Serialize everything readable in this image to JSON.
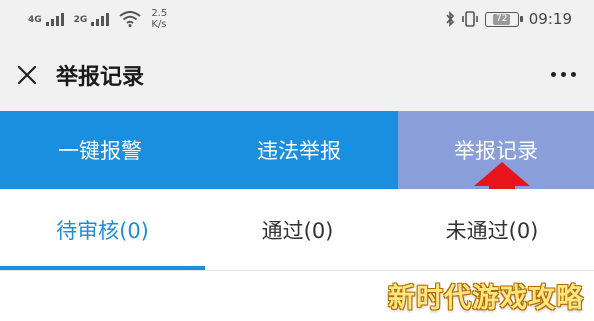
{
  "status_bar": {
    "signal1_tag": "4G",
    "signal2_tag": "2G",
    "net_speed_value": "2.5",
    "net_speed_unit": "K/s",
    "battery_level": "72",
    "time": "09:19",
    "icons": [
      "signal-icon",
      "signal-icon",
      "wifi-icon",
      "bluetooth-icon",
      "vibrate-icon",
      "battery-icon"
    ]
  },
  "header": {
    "title": "举报记录",
    "close_icon": "close-icon",
    "more_icon": "more-icon"
  },
  "nav": {
    "tabs": [
      {
        "label": "一键报警"
      },
      {
        "label": "违法举报"
      },
      {
        "label": "举报记录"
      }
    ],
    "active_index": 2
  },
  "sub_tabs": {
    "items": [
      {
        "label": "待审核(0)"
      },
      {
        "label": "通过(0)"
      },
      {
        "label": "未通过(0)"
      }
    ],
    "active_index": 0
  },
  "watermark": "新时代游戏攻略",
  "colors": {
    "accent": "#1a8fe0",
    "nav_active": "#8a9fda",
    "arrow": "#e8141c",
    "header_bg": "#f1f1f1"
  }
}
